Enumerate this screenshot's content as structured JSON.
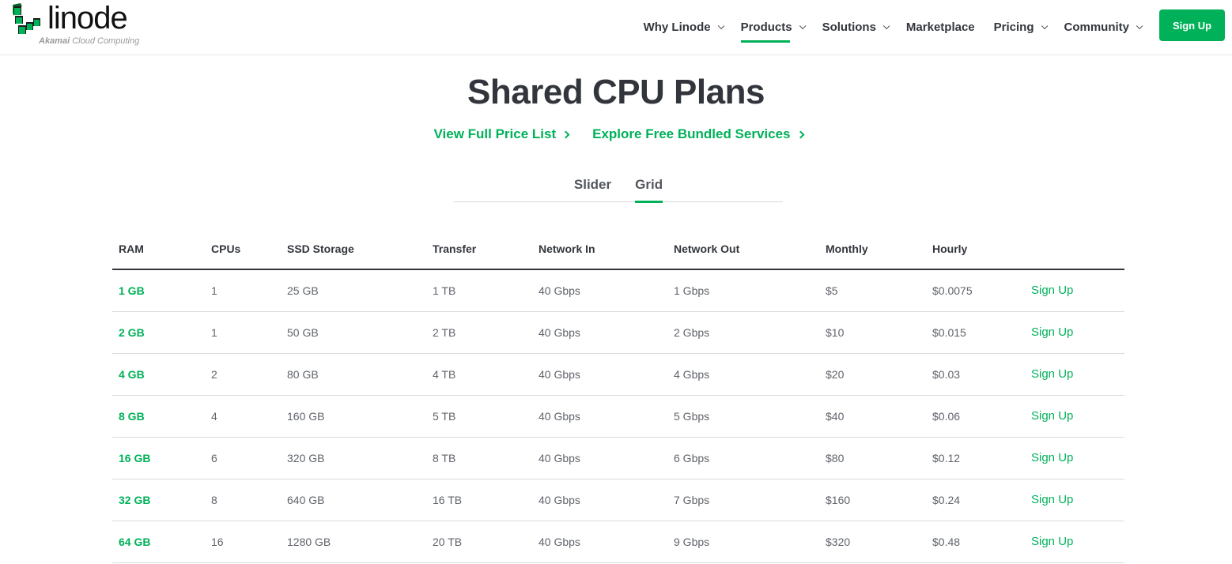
{
  "header": {
    "logo": {
      "wordmark": "linode",
      "tagline_bold": "Akamai",
      "tagline_rest": " Cloud Computing"
    },
    "nav": [
      {
        "label": "Why Linode",
        "has_dropdown": true,
        "active": false
      },
      {
        "label": "Products",
        "has_dropdown": true,
        "active": true
      },
      {
        "label": "Solutions",
        "has_dropdown": true,
        "active": false
      },
      {
        "label": "Marketplace",
        "has_dropdown": false,
        "active": false
      },
      {
        "label": "Pricing",
        "has_dropdown": true,
        "active": false
      },
      {
        "label": "Community",
        "has_dropdown": true,
        "active": false
      }
    ],
    "signup_label": "Sign Up"
  },
  "hero": {
    "title": "Shared CPU Plans",
    "links": [
      {
        "label": "View Full Price List"
      },
      {
        "label": "Explore Free Bundled Services"
      }
    ]
  },
  "tabs": [
    {
      "label": "Slider",
      "active": false
    },
    {
      "label": "Grid",
      "active": true
    }
  ],
  "table": {
    "columns": [
      "RAM",
      "CPUs",
      "SSD Storage",
      "Transfer",
      "Network In",
      "Network Out",
      "Monthly",
      "Hourly",
      ""
    ],
    "rows": [
      {
        "ram": "1 GB",
        "cpus": "1",
        "storage": "25 GB",
        "transfer": "1 TB",
        "net_in": "40 Gbps",
        "net_out": "1 Gbps",
        "monthly": "$5",
        "hourly": "$0.0075",
        "action": "Sign Up"
      },
      {
        "ram": "2 GB",
        "cpus": "1",
        "storage": "50 GB",
        "transfer": "2 TB",
        "net_in": "40 Gbps",
        "net_out": "2 Gbps",
        "monthly": "$10",
        "hourly": "$0.015",
        "action": "Sign Up"
      },
      {
        "ram": "4 GB",
        "cpus": "2",
        "storage": "80 GB",
        "transfer": "4 TB",
        "net_in": "40 Gbps",
        "net_out": "4 Gbps",
        "monthly": "$20",
        "hourly": "$0.03",
        "action": "Sign Up"
      },
      {
        "ram": "8 GB",
        "cpus": "4",
        "storage": "160 GB",
        "transfer": "5 TB",
        "net_in": "40 Gbps",
        "net_out": "5 Gbps",
        "monthly": "$40",
        "hourly": "$0.06",
        "action": "Sign Up"
      },
      {
        "ram": "16 GB",
        "cpus": "6",
        "storage": "320 GB",
        "transfer": "8 TB",
        "net_in": "40 Gbps",
        "net_out": "6 Gbps",
        "monthly": "$80",
        "hourly": "$0.12",
        "action": "Sign Up"
      },
      {
        "ram": "32 GB",
        "cpus": "8",
        "storage": "640 GB",
        "transfer": "16 TB",
        "net_in": "40 Gbps",
        "net_out": "7 Gbps",
        "monthly": "$160",
        "hourly": "$0.24",
        "action": "Sign Up"
      },
      {
        "ram": "64 GB",
        "cpus": "16",
        "storage": "1280 GB",
        "transfer": "20 TB",
        "net_in": "40 Gbps",
        "net_out": "9 Gbps",
        "monthly": "$320",
        "hourly": "$0.48",
        "action": "Sign Up"
      }
    ]
  },
  "colors": {
    "brand_green": "#00b159",
    "text_dark": "#32363c",
    "text_muted": "#5f636a"
  }
}
